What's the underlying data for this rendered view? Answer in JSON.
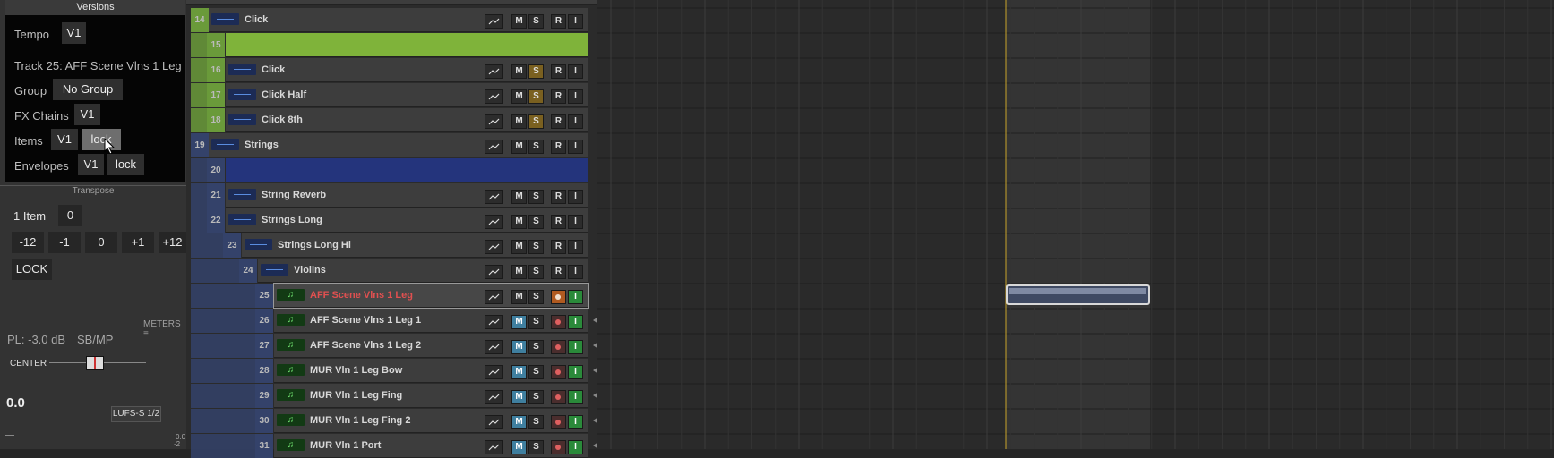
{
  "versions": {
    "title": "Versions",
    "tempo_label": "Tempo",
    "tempo_value": "V1",
    "track_label": "Track 25: AFF Scene Vlns 1 Leg",
    "group_label": "Group",
    "group_value": "No Group",
    "fx_label": "FX Chains",
    "fx_value": "V1",
    "items_label": "Items",
    "items_value": "V1",
    "items_lock": "lock",
    "env_label": "Envelopes",
    "env_value": "V1",
    "env_lock": "lock"
  },
  "transpose": {
    "title": "Transpose",
    "item_label": "1 Item",
    "item_value": "0",
    "buttons": [
      "-12",
      "-1",
      "0",
      "+1",
      "+12"
    ],
    "lock": "LOCK"
  },
  "mixer": {
    "meters_label": "METERS ≡",
    "pl_label": "PL: -3.0 dB",
    "sbmp": "SB/MP",
    "pan_label": "CENTER",
    "volume": "0.0",
    "lufs": "LUFS-S 1/2",
    "scale_a": "0.0",
    "scale_b": "-2"
  },
  "buttons": {
    "m": "M",
    "s": "S",
    "r": "R",
    "i": "I"
  },
  "tracks": [
    {
      "num": "14",
      "name": "Click",
      "depth": 0,
      "color": "#6a9a3a",
      "type": "audio"
    },
    {
      "num": "15",
      "name": "",
      "depth": 1,
      "color": "#6a9a3a",
      "type": "folder-green"
    },
    {
      "num": "16",
      "name": "Click",
      "depth": 1,
      "color": "#6a9a3a",
      "type": "audio",
      "solo": true
    },
    {
      "num": "17",
      "name": "Click Half",
      "depth": 1,
      "color": "#6a9a3a",
      "type": "audio",
      "solo": true
    },
    {
      "num": "18",
      "name": "Click 8th",
      "depth": 1,
      "color": "#6a9a3a",
      "type": "audio",
      "solo": true
    },
    {
      "num": "19",
      "name": "Strings",
      "depth": 0,
      "color": "#34426a",
      "type": "audio"
    },
    {
      "num": "20",
      "name": "",
      "depth": 1,
      "color": "#34426a",
      "type": "folder-blue"
    },
    {
      "num": "21",
      "name": "String Reverb",
      "depth": 1,
      "color": "#34426a",
      "type": "audio"
    },
    {
      "num": "22",
      "name": "Strings Long",
      "depth": 1,
      "color": "#34426a",
      "type": "audio"
    },
    {
      "num": "23",
      "name": "Strings Long Hi",
      "depth": 2,
      "color": "#34426a",
      "type": "audio"
    },
    {
      "num": "24",
      "name": "Violins",
      "depth": 3,
      "color": "#34426a",
      "type": "audio"
    },
    {
      "num": "25",
      "name": "AFF Scene Vlns 1 Leg",
      "depth": 4,
      "color": "#34426a",
      "type": "midi",
      "selected": true
    },
    {
      "num": "26",
      "name": "AFF Scene Vlns 1 Leg 1",
      "depth": 4,
      "color": "#34426a",
      "type": "midi"
    },
    {
      "num": "27",
      "name": "AFF Scene Vlns 1 Leg 2",
      "depth": 4,
      "color": "#34426a",
      "type": "midi"
    },
    {
      "num": "28",
      "name": "MUR Vln 1 Leg Bow",
      "depth": 4,
      "color": "#34426a",
      "type": "midi"
    },
    {
      "num": "29",
      "name": "MUR Vln 1 Leg Fing",
      "depth": 4,
      "color": "#34426a",
      "type": "midi"
    },
    {
      "num": "30",
      "name": "MUR Vln 1 Leg Fing 2",
      "depth": 4,
      "color": "#34426a",
      "type": "midi"
    },
    {
      "num": "31",
      "name": "MUR Vln 1 Port",
      "depth": 4,
      "color": "#34426a",
      "type": "midi"
    }
  ],
  "icons": {
    "envelope": "envelope-icon",
    "wave": "waveform-icon",
    "midi": "midi-note-icon",
    "cursor": "mouse-cursor-icon"
  }
}
